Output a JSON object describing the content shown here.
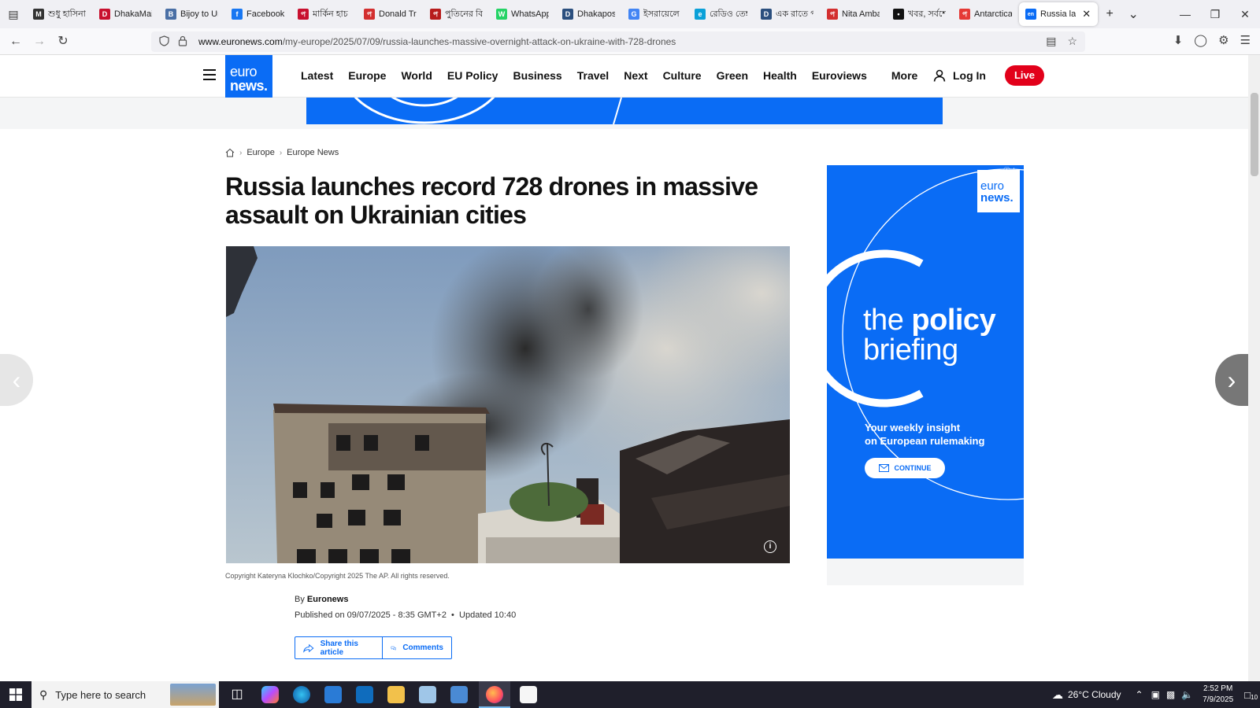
{
  "browser": {
    "tabs": [
      {
        "title": "শুধু হাসিনা",
        "color": "#333333",
        "glyph": "M"
      },
      {
        "title": "DhakaMail",
        "color": "#c8102e",
        "glyph": "D"
      },
      {
        "title": "Bijoy to Ur",
        "color": "#4a6fa5",
        "glyph": "B"
      },
      {
        "title": "Facebook",
        "color": "#1877f2",
        "glyph": "f"
      },
      {
        "title": "মার্কিন হাচ",
        "color": "#c8102e",
        "glyph": "প"
      },
      {
        "title": "Donald Tru",
        "color": "#d32f2f",
        "glyph": "প"
      },
      {
        "title": "পুতিনের বি",
        "color": "#b71c1c",
        "glyph": "প"
      },
      {
        "title": "WhatsApp",
        "color": "#25d366",
        "glyph": "W"
      },
      {
        "title": "Dhakapost",
        "color": "#2b4f7e",
        "glyph": "D"
      },
      {
        "title": "ইসরায়েলে",
        "color": "#4285f4",
        "glyph": "G"
      },
      {
        "title": "রেডিও তেহ",
        "color": "#0aa0d8",
        "glyph": "e"
      },
      {
        "title": "এক রাতে প",
        "color": "#2b4f7e",
        "glyph": "D"
      },
      {
        "title": "Nita Amba",
        "color": "#d32f2f",
        "glyph": "প"
      },
      {
        "title": "খবর, সর্বশে",
        "color": "#111111",
        "glyph": "•"
      },
      {
        "title": "Antarctica",
        "color": "#e53935",
        "glyph": "প"
      }
    ],
    "active_tab": {
      "title": "Russia la",
      "glyph": "en"
    },
    "url_domain": "www.euronews.com",
    "url_path": "/my-europe/2025/07/09/russia-launches-massive-overnight-attack-on-ukraine-with-728-drones"
  },
  "site": {
    "logo_top": "euro",
    "logo_bottom": "news.",
    "nav": [
      "Latest",
      "Europe",
      "World",
      "EU Policy",
      "Business",
      "Travel",
      "Next",
      "Culture",
      "Green",
      "Health",
      "Euroviews"
    ],
    "more": "More",
    "login": "Log In",
    "live": "Live"
  },
  "article": {
    "breadcrumb": [
      "Europe",
      "Europe News"
    ],
    "headline": "Russia launches record 728 drones in massive assault on Ukrainian cities",
    "caption": "Copyright Kateryna Klochko/Copyright 2025 The AP. All rights reserved.",
    "by_prefix": "By",
    "author": "Euronews",
    "published": "Published on 09/07/2025 - 8:35 GMT+2",
    "updated": "Updated 10:40",
    "share": "Share this article",
    "comments": "Comments"
  },
  "side_ad": {
    "logo_top": "euro",
    "logo_bottom": "news.",
    "the": "the",
    "policy": "policy",
    "briefing": "briefing",
    "line1": "Your weekly insight",
    "line2": "on European rulemaking",
    "cta": "CONTINUE"
  },
  "taskbar": {
    "search_placeholder": "Type here to search",
    "weather": "26°C  Cloudy",
    "time": "2:52 PM",
    "date": "7/9/2025",
    "notifications": "10"
  }
}
